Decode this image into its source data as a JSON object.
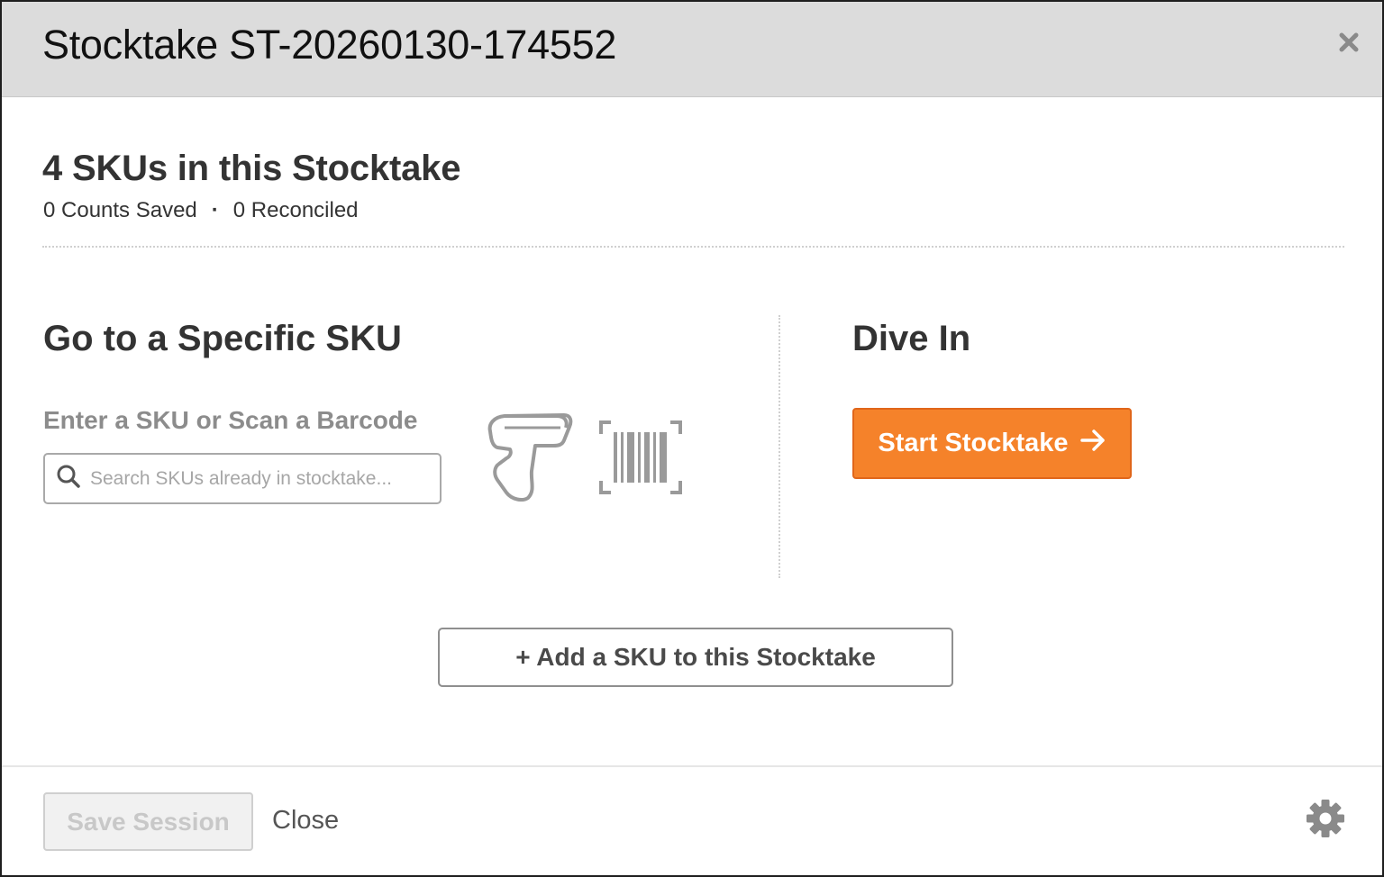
{
  "modal": {
    "title": "Stocktake ST-20260130-174552",
    "close_icon": "close-x-icon"
  },
  "summary": {
    "title": "4 SKUs in this Stocktake",
    "counts_saved": "0 Counts Saved",
    "separator": "·",
    "reconciled": "0 Reconciled"
  },
  "goto_sku": {
    "title": "Go to a Specific SKU",
    "label": "Enter a SKU or Scan a Barcode",
    "search_placeholder": "Search SKUs already in stocktake...",
    "search_value": "",
    "icons": [
      "search-icon",
      "barcode-scanner-icon",
      "barcode-icon"
    ]
  },
  "dive_in": {
    "title": "Dive In",
    "start_label": "Start Stocktake",
    "start_icon": "arrow-right-icon"
  },
  "add_sku": {
    "label": "+ Add a SKU to this Stocktake"
  },
  "footer": {
    "save_label": "Save Session",
    "close_label": "Close",
    "settings_icon": "gear-icon"
  },
  "colors": {
    "accent": "#f5822a",
    "header_bg": "#dcdcdc",
    "muted_text": "#8c8c8c"
  }
}
